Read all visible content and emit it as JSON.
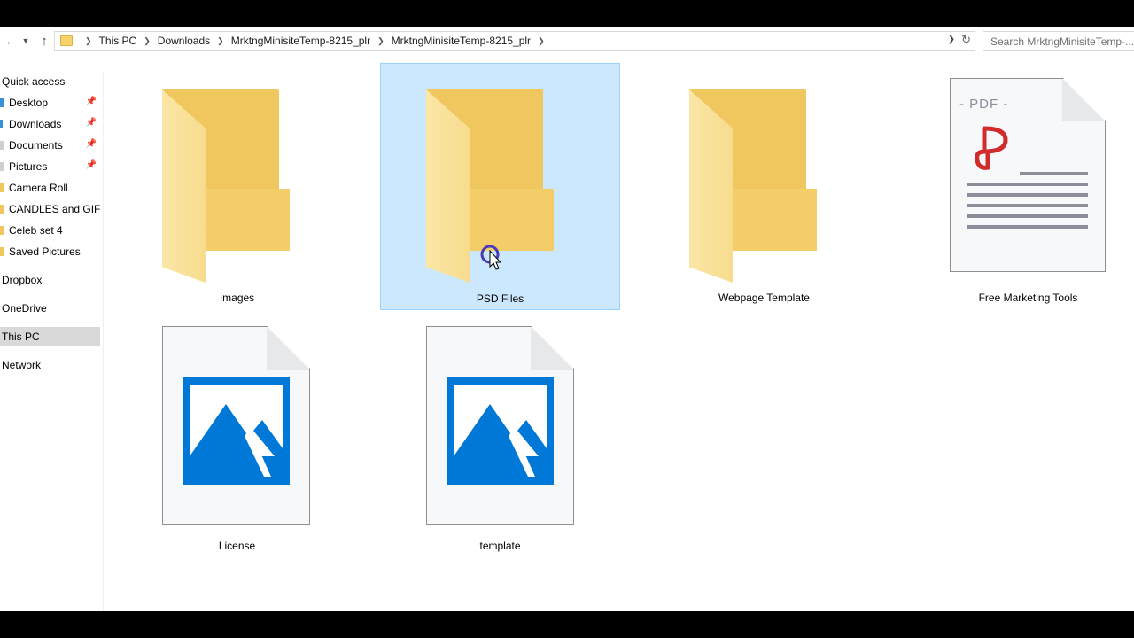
{
  "address_bar": {
    "breadcrumbs": [
      "This PC",
      "Downloads",
      "MrktngMinisiteTemp-8215_plr",
      "MrktngMinisiteTemp-8215_plr"
    ],
    "search_placeholder": "Search MrktngMinisiteTemp-..."
  },
  "sidebar": {
    "quick_access": "Quick access",
    "pinned": [
      {
        "label": "Desktop",
        "icon": "desktop-icon",
        "pinned": true
      },
      {
        "label": "Downloads",
        "icon": "downloads-icon",
        "pinned": true
      },
      {
        "label": "Documents",
        "icon": "documents-icon",
        "pinned": true
      },
      {
        "label": "Pictures",
        "icon": "pictures-icon",
        "pinned": true
      },
      {
        "label": "Camera Roll",
        "icon": "folder-icon",
        "pinned": false
      },
      {
        "label": "CANDLES and GIFTS",
        "icon": "folder-icon",
        "pinned": false
      },
      {
        "label": "Celeb set 4",
        "icon": "folder-icon",
        "pinned": false
      },
      {
        "label": "Saved Pictures",
        "icon": "folder-icon",
        "pinned": false
      }
    ],
    "dropbox": "Dropbox",
    "onedrive": "OneDrive",
    "this_pc": "This PC",
    "network": "Network"
  },
  "files": [
    {
      "name": "Images",
      "type": "folder",
      "selected": false
    },
    {
      "name": "PSD Files",
      "type": "folder",
      "selected": true
    },
    {
      "name": "Webpage Template",
      "type": "folder",
      "selected": false
    },
    {
      "name": "Free Marketing Tools",
      "type": "pdf",
      "selected": false
    },
    {
      "name": "License",
      "type": "image",
      "selected": false
    },
    {
      "name": "template",
      "type": "image",
      "selected": false
    }
  ],
  "pdf_icon_text": "- PDF -",
  "colors": {
    "selection_bg": "#cce8ff",
    "selection_border": "#99d1ff",
    "folder": "#f4d27a",
    "image_icon_blue": "#0078d7",
    "pdf_red": "#d22b2b"
  }
}
